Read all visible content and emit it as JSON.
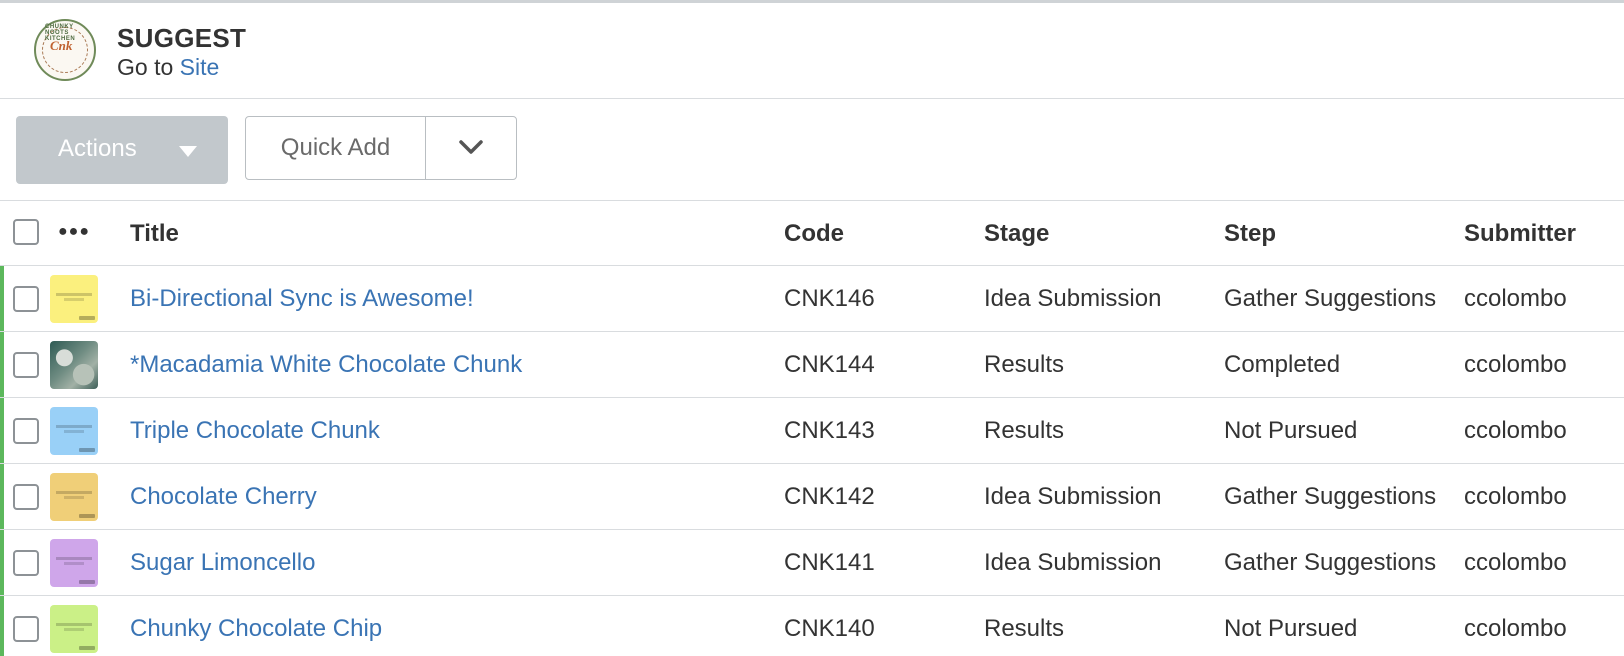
{
  "app": {
    "title": "SUGGEST",
    "goto_prefix": "Go to",
    "site_link": "Site",
    "logo_name": "chunky-noots-kitchen-logo",
    "logo_text": "Cnk",
    "logo_arc_text": "CHUNKY NOOTS KITCHEN"
  },
  "toolbar": {
    "actions_label": "Actions",
    "quick_add_label": "Quick Add"
  },
  "table": {
    "columns": {
      "title": "Title",
      "code": "Code",
      "stage": "Stage",
      "step": "Step",
      "submitter": "Submitter"
    },
    "rows": [
      {
        "title": "Bi-Directional Sync is Awesome!",
        "code": "CNK146",
        "stage": "Idea Submission",
        "step": "Gather Suggestions",
        "submitter": "ccolombo",
        "thumb_color": "#fbf07e"
      },
      {
        "title": "*Macadamia White Chocolate Chunk",
        "code": "CNK144",
        "stage": "Results",
        "step": "Completed",
        "submitter": "ccolombo",
        "thumb_color": "photo"
      },
      {
        "title": "Triple Chocolate Chunk",
        "code": "CNK143",
        "stage": "Results",
        "step": "Not Pursued",
        "submitter": "ccolombo",
        "thumb_color": "#99d0f7"
      },
      {
        "title": "Chocolate Cherry",
        "code": "CNK142",
        "stage": "Idea Submission",
        "step": "Gather Suggestions",
        "submitter": "ccolombo",
        "thumb_color": "#f0cf78"
      },
      {
        "title": "Sugar Limoncello",
        "code": "CNK141",
        "stage": "Idea Submission",
        "step": "Gather Suggestions",
        "submitter": "ccolombo",
        "thumb_color": "#cfa6ea"
      },
      {
        "title": "Chunky Chocolate Chip",
        "code": "CNK140",
        "stage": "Results",
        "step": "Not Pursued",
        "submitter": "ccolombo",
        "thumb_color": "#cbf087"
      }
    ]
  },
  "colors": {
    "link": "#3a74b4",
    "status_bar": "#5cb85c",
    "actions_bg": "#c2c8cc"
  }
}
